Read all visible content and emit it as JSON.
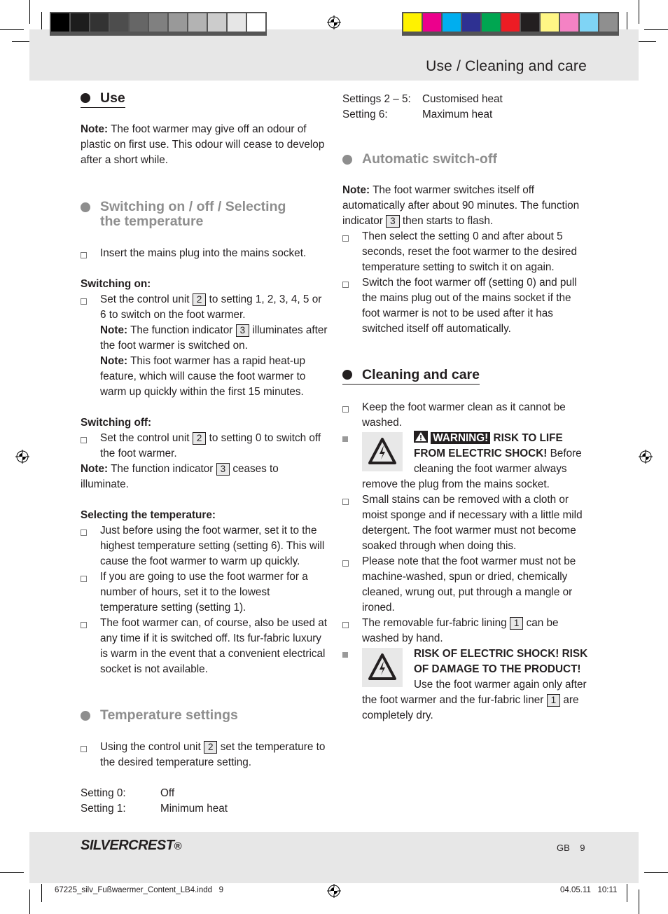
{
  "color_bar": {
    "gray": [
      "#000000",
      "#1d1d1d",
      "#333333",
      "#4d4d4d",
      "#666666",
      "#808080",
      "#999999",
      "#b3b3b3",
      "#cccccc",
      "#e6e6e6",
      "#ffffff"
    ],
    "process": [
      "#fff200",
      "#ec008c",
      "#00aeef",
      "#2e3192",
      "#00a651",
      "#ed1c24",
      "#231f20",
      "#fff685",
      "#f482c4",
      "#7fd4f5",
      "#8f8f8f"
    ]
  },
  "header": {
    "title": "Use / Cleaning and care"
  },
  "left": {
    "use": {
      "heading": "Use",
      "note_label": "Note:",
      "note_text": " The foot warmer may give off an odour of plastic on first use. This odour will cease to develop after a short while."
    },
    "switching": {
      "heading": "Switching on / off / Selecting the temperature",
      "item1": "Insert the mains plug into the mains socket.",
      "on_label": "Switching on:",
      "on_item_a": "Set the control unit ",
      "on_item_ref": "2",
      "on_item_b": " to setting 1, 2, 3, 4, 5 or 6 to switch on the foot warmer.",
      "on_note1_label": "Note:",
      "on_note1_a": " The function indicator ",
      "on_note1_ref": "3",
      "on_note1_b": " illuminates after the foot warmer is switched on.",
      "on_note2_label": "Note:",
      "on_note2_text": " This foot warmer has a rapid heat-up feature, which will cause the foot warmer to warm up quickly within the first 15 minutes.",
      "off_label": "Switching off:",
      "off_item_a": "Set the control unit ",
      "off_item_ref": "2",
      "off_item_b": " to setting 0 to switch off the foot warmer.",
      "off_note_label": "Note:",
      "off_note_a": " The function indicator ",
      "off_note_ref": "3",
      "off_note_b": " ceases to illuminate.",
      "select_label": "Selecting the temperature:",
      "select_items": [
        "Just before using the foot warmer, set it to the highest temperature setting (setting 6). This will cause the foot warmer to warm up quickly.",
        "If you are going to use the foot warmer for a number of hours, set it to the lowest temperature setting (setting 1).",
        "The foot warmer can, of course, also be used at any time if it is switched off. Its fur-fabric luxury is warm in the event that a convenient electrical socket is not available."
      ]
    },
    "temperature": {
      "heading": "Temperature settings",
      "item_a": "Using the control unit ",
      "item_ref": "2",
      "item_b": " set the temperature to the desired temperature setting.",
      "settings": [
        {
          "key": "Setting 0:",
          "value": "Off"
        },
        {
          "key": "Setting 1:",
          "value": "Minimum heat"
        }
      ]
    }
  },
  "right": {
    "settings": [
      {
        "key": "Settings 2 – 5:",
        "value": "Customised heat"
      },
      {
        "key": "Setting 6:",
        "value": "Maximum heat"
      }
    ],
    "auto_off": {
      "heading": "Automatic switch-off",
      "note_label": "Note:",
      "note_a": " The foot warmer switches itself off automatically after about 90 minutes. The function indicator ",
      "note_ref": "3",
      "note_b": " then starts to flash.",
      "items": [
        "Then select the setting 0 and after about 5 seconds, reset the foot warmer to the desired temperature setting to switch it on again.",
        "Switch the foot warmer off (setting 0) and pull the mains plug out of the mains socket if the foot warmer is not to be used after it has switched itself off automatically."
      ]
    },
    "cleaning": {
      "heading": "Cleaning and care",
      "item1": "Keep the foot warmer clean as it cannot be washed.",
      "warning1_label": "WARNING!",
      "warning1_bold": " RISK TO LIFE FROM ELECTRIC SHOCK!",
      "warning1_text": " Before cleaning the foot warmer always remove the plug from the mains socket.",
      "item2": "Small stains can be removed with a cloth or moist sponge and if necessary with a little mild detergent. The foot warmer must not become soaked through when doing this.",
      "item3": "Please note that the foot warmer must not be machine-washed, spun or dried, chemically cleaned, wrung out, put through a mangle or ironed.",
      "item4_a": "The removable fur-fabric lining ",
      "item4_ref": "1",
      "item4_b": " can be washed by hand.",
      "warning2_bold": "RISK OF ELECTRIC SHOCK! RISK OF DAMAGE TO THE PRODUCT!",
      "warning2_a": " Use the foot warmer again only after the foot warmer and the fur-fabric liner ",
      "warning2_ref": "1",
      "warning2_b": " are completely dry."
    }
  },
  "footer": {
    "brand": "SILVERCREST",
    "brand_mark": "®",
    "lang": "GB",
    "page": "9",
    "slug_file": "67225_silv_Fußwaermer_Content_LB4.indd   9",
    "slug_date": "04.05.11   10:11"
  }
}
